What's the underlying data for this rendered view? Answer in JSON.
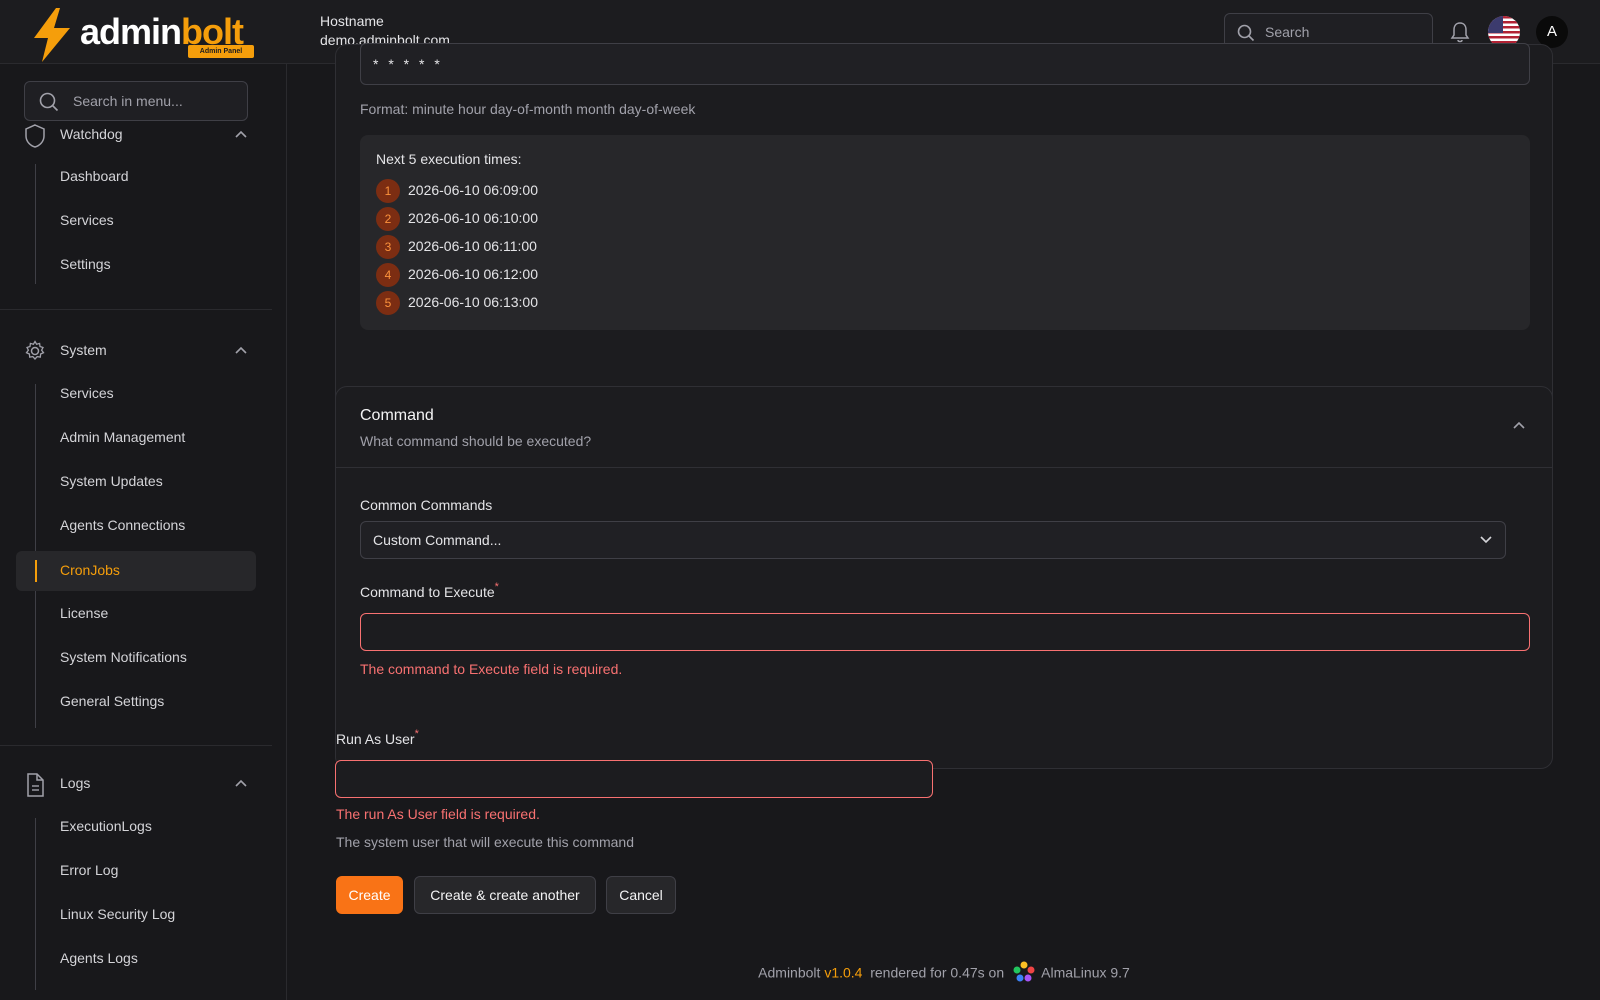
{
  "brand": {
    "word1": "admin",
    "word2": "bolt",
    "tag": "Admin Panel"
  },
  "header": {
    "host_label": "Hostname",
    "host_value": "demo.adminbolt.com",
    "search_placeholder": "Search",
    "avatar_initial": "A"
  },
  "sidebar": {
    "search_placeholder": "Search in menu...",
    "groups": [
      {
        "label": "Watchdog",
        "icon": "shield-icon",
        "items": [
          "Dashboard",
          "Services",
          "Settings"
        ]
      },
      {
        "label": "System",
        "icon": "gear-icon",
        "items": [
          "Services",
          "Admin Management",
          "System Updates",
          "Agents Connections",
          "CronJobs",
          "License",
          "System Notifications",
          "General Settings"
        ],
        "active": "CronJobs"
      },
      {
        "label": "Logs",
        "icon": "document-icon",
        "items": [
          "ExecutionLogs",
          "Error Log",
          "Linux Security Log",
          "Agents Logs"
        ]
      }
    ]
  },
  "schedule": {
    "cron_value": "* * * * *",
    "format_hint": "Format: minute hour day-of-month month day-of-week",
    "next_title": "Next 5 execution times:",
    "next_times": [
      {
        "n": "1",
        "t": "2026-06-10 06:09:00"
      },
      {
        "n": "2",
        "t": "2026-06-10 06:10:00"
      },
      {
        "n": "3",
        "t": "2026-06-10 06:11:00"
      },
      {
        "n": "4",
        "t": "2026-06-10 06:12:00"
      },
      {
        "n": "5",
        "t": "2026-06-10 06:13:00"
      }
    ]
  },
  "command": {
    "heading": "Command",
    "subheading": "What command should be executed?",
    "common_label": "Common Commands",
    "common_value": "Custom Command...",
    "exec_label": "Command to Execute",
    "exec_value": "",
    "exec_error": "The command to Execute field is required."
  },
  "run_as": {
    "label": "Run As User",
    "value": "",
    "error": "The run As User field is required.",
    "help": "The system user that will execute this command"
  },
  "actions": {
    "create": "Create",
    "create_another": "Create & create another",
    "cancel": "Cancel"
  },
  "footer": {
    "prefix": "Adminbolt",
    "version": "v1.0.4",
    "rendered": "rendered for 0.47s on",
    "os": "AlmaLinux 9.7"
  },
  "colors": {
    "accent": "#f59e0b",
    "primary_button": "#f97316",
    "error": "#f87171",
    "background": "#18181b"
  }
}
